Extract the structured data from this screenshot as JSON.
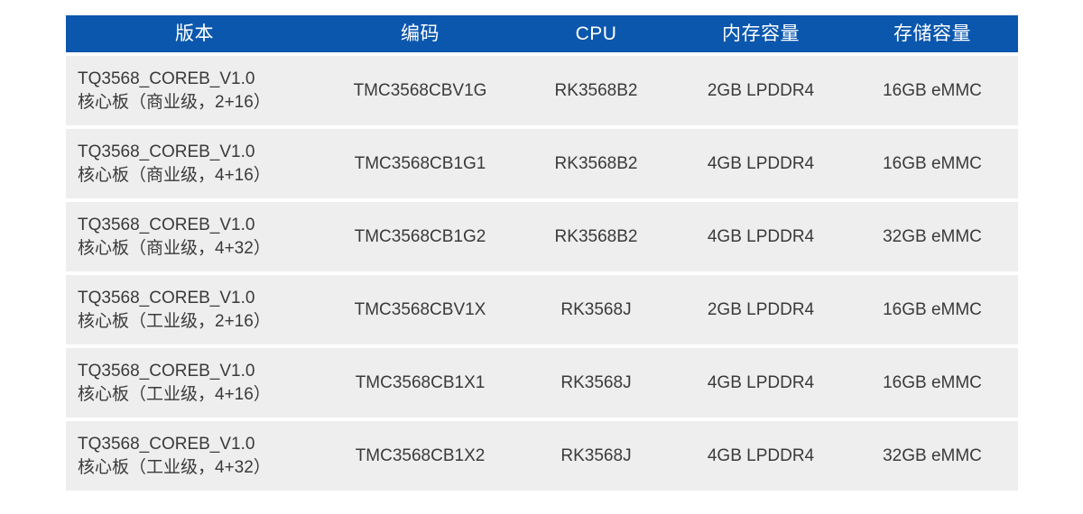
{
  "table": {
    "columns": [
      {
        "key": "version",
        "label": "版本"
      },
      {
        "key": "code",
        "label": "编码"
      },
      {
        "key": "cpu",
        "label": "CPU"
      },
      {
        "key": "memory",
        "label": "内存容量"
      },
      {
        "key": "storage",
        "label": "存储容量"
      }
    ],
    "header_background": "#0b57ae",
    "header_text_color": "#ffffff",
    "row_background": "#eeeeee",
    "row_text_color": "#3a3a3a",
    "rows": [
      {
        "version_line1": "TQ3568_COREB_V1.0",
        "version_line2": "核心板（商业级，2+16）",
        "code": "TMC3568CBV1G",
        "cpu": "RK3568B2",
        "memory": "2GB LPDDR4",
        "storage": "16GB eMMC"
      },
      {
        "version_line1": "TQ3568_COREB_V1.0",
        "version_line2": "核心板（商业级，4+16）",
        "code": "TMC3568CB1G1",
        "cpu": "RK3568B2",
        "memory": "4GB LPDDR4",
        "storage": "16GB eMMC"
      },
      {
        "version_line1": "TQ3568_COREB_V1.0",
        "version_line2": "核心板（商业级，4+32）",
        "code": "TMC3568CB1G2",
        "cpu": "RK3568B2",
        "memory": "4GB LPDDR4",
        "storage": "32GB eMMC"
      },
      {
        "version_line1": "TQ3568_COREB_V1.0",
        "version_line2": "核心板（工业级，2+16）",
        "code": "TMC3568CBV1X",
        "cpu": "RK3568J",
        "memory": "2GB LPDDR4",
        "storage": "16GB eMMC"
      },
      {
        "version_line1": "TQ3568_COREB_V1.0",
        "version_line2": "核心板（工业级，4+16）",
        "code": "TMC3568CB1X1",
        "cpu": "RK3568J",
        "memory": "4GB LPDDR4",
        "storage": "16GB eMMC"
      },
      {
        "version_line1": "TQ3568_COREB_V1.0",
        "version_line2": "核心板（工业级，4+32）",
        "code": "TMC3568CB1X2",
        "cpu": "RK3568J",
        "memory": "4GB LPDDR4",
        "storage": "32GB eMMC"
      }
    ]
  }
}
